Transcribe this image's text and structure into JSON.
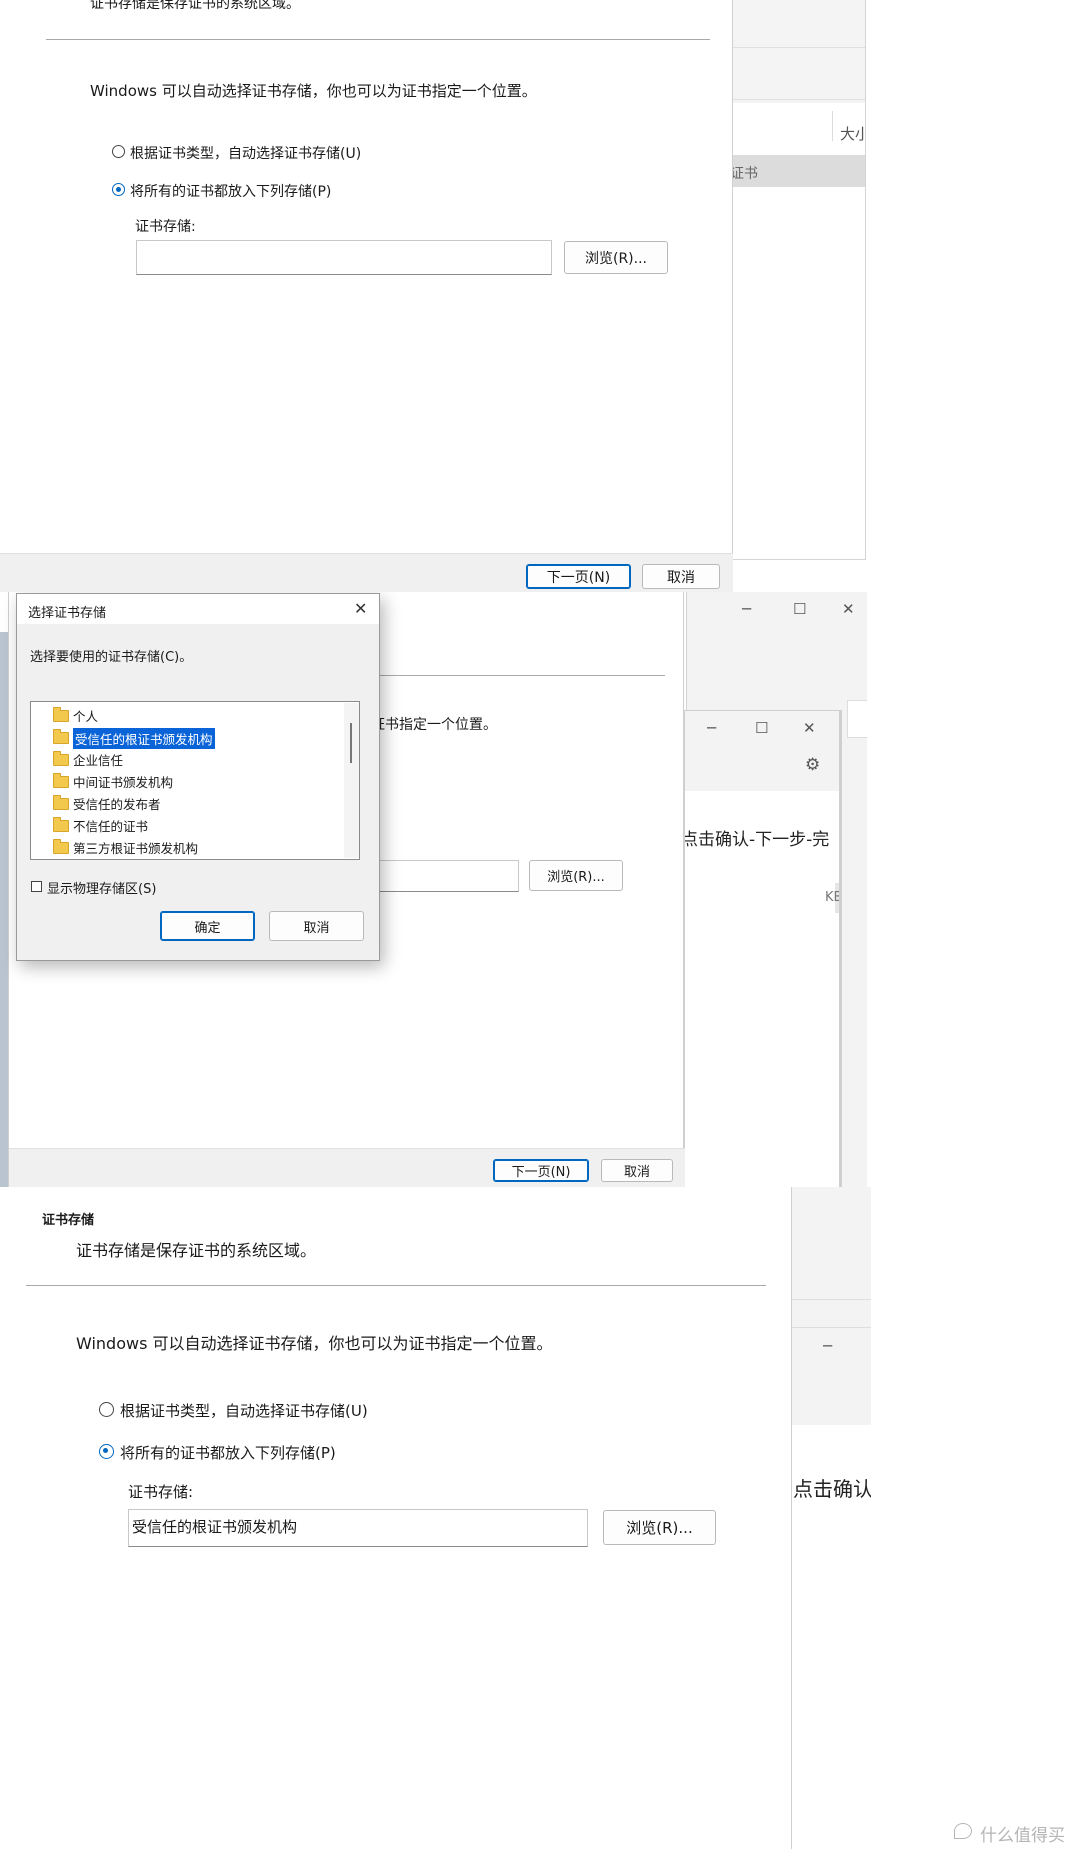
{
  "top": {
    "header_desc": "证书存储是保存证书的系统区域。",
    "intro": "Windows 可以自动选择证书存储，你也可以为证书指定一个位置。",
    "radio_auto": "根据证书类型，自动选择证书存储(U)",
    "radio_manual": "将所有的证书都放入下列存储(P)",
    "store_label": "证书存储:",
    "store_value": "",
    "browse": "浏览(R)...",
    "next": "下一页(N)",
    "cancel": "取消"
  },
  "bg_top": {
    "col_size": "大小",
    "row_text": "证书"
  },
  "middle": {
    "wizard": {
      "intro_partial": "证书指定一个位置。",
      "browse": "浏览(R)...",
      "next": "下一页(N)",
      "cancel": "取消"
    },
    "bg": {
      "instruction": "点击确认-下一步-完",
      "size_badge": "KB"
    },
    "dialog": {
      "title": "选择证书存储",
      "prompt": "选择要使用的证书存储(C)。",
      "stores": [
        {
          "label": "个人",
          "selected": false
        },
        {
          "label": "受信任的根证书颁发机构",
          "selected": true
        },
        {
          "label": "企业信任",
          "selected": false
        },
        {
          "label": "中间证书颁发机构",
          "selected": false
        },
        {
          "label": "受信任的发布者",
          "selected": false
        },
        {
          "label": "不信任的证书",
          "selected": false
        },
        {
          "label": "第三方根证书颁发机构",
          "selected": false
        }
      ],
      "show_physical": "显示物理存储区(S)",
      "ok": "确定",
      "cancel": "取消"
    }
  },
  "bottom": {
    "header_title": "证书存储",
    "header_desc": "证书存储是保存证书的系统区域。",
    "intro": "Windows 可以自动选择证书存储，你也可以为证书指定一个位置。",
    "radio_auto": "根据证书类型，自动选择证书存储(U)",
    "radio_manual": "将所有的证书都放入下列存储(P)",
    "store_label": "证书存储:",
    "store_value": "受信任的根证书颁发机构",
    "browse": "浏览(R)...",
    "bg_instruction": "点击确认"
  },
  "watermark": "什么值得买",
  "colors": {
    "accent": "#0067c0",
    "selection": "#0a64d8",
    "folder": "#f2c94c"
  }
}
